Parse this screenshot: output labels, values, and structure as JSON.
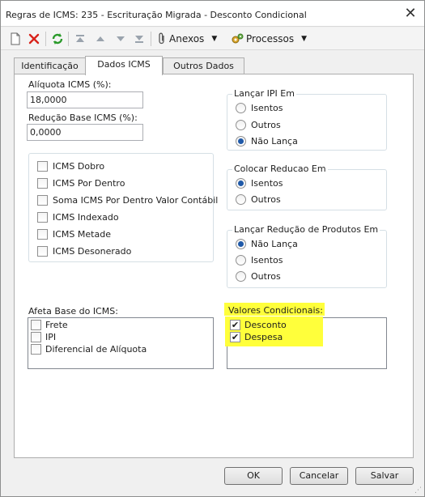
{
  "window": {
    "title": "Regras de ICMS: 235 - Escrituração Migrada - Desconto Condicional",
    "close_glyph": "✕"
  },
  "toolbar": {
    "icons": [
      "new-icon",
      "delete-icon",
      "refresh-icon",
      "first-icon",
      "previous-icon",
      "next-icon",
      "last-icon"
    ],
    "anexos_label": "Anexos",
    "processos_label": "Processos"
  },
  "tabs": [
    {
      "label": "Identificação",
      "active": false
    },
    {
      "label": "Dados ICMS",
      "active": true
    },
    {
      "label": "Outros Dados",
      "active": false
    }
  ],
  "fields": {
    "aliquota_label": "Alíquota ICMS (%):",
    "aliquota_value": "18,0000",
    "reducao_label": "Redução Base ICMS (%):",
    "reducao_value": "0,0000"
  },
  "icms_options": [
    {
      "label": "ICMS Dobro",
      "checked": false
    },
    {
      "label": "ICMS Por Dentro",
      "checked": false
    },
    {
      "label": "Soma ICMS Por Dentro Valor Contábil",
      "checked": false
    },
    {
      "label": "ICMS Indexado",
      "checked": false
    },
    {
      "label": "ICMS Metade",
      "checked": false
    },
    {
      "label": "ICMS Desonerado",
      "checked": false
    }
  ],
  "lancar_ipi": {
    "title": "Lançar IPI Em",
    "options": [
      {
        "label": "Isentos",
        "selected": false
      },
      {
        "label": "Outros",
        "selected": false
      },
      {
        "label": "Não Lança",
        "selected": true
      }
    ]
  },
  "colocar_reducao": {
    "title": "Colocar Reducao Em",
    "options": [
      {
        "label": "Isentos",
        "selected": true
      },
      {
        "label": "Outros",
        "selected": false
      }
    ]
  },
  "lancar_reducao_produtos": {
    "title": "Lançar Redução de Produtos Em",
    "options": [
      {
        "label": "Não Lança",
        "selected": true
      },
      {
        "label": "Isentos",
        "selected": false
      },
      {
        "label": "Outros",
        "selected": false
      }
    ]
  },
  "afeta_base": {
    "title": "Afeta Base do ICMS:",
    "items": [
      {
        "label": "Frete",
        "checked": false
      },
      {
        "label": "IPI",
        "checked": false
      },
      {
        "label": "Diferencial de Alíquota",
        "checked": false
      }
    ]
  },
  "valores_condicionais": {
    "title": "Valores Condicionais:",
    "items": [
      {
        "label": "Desconto",
        "checked": true
      },
      {
        "label": "Despesa",
        "checked": true
      }
    ],
    "highlight_color": "#ffff3b"
  },
  "buttons": {
    "ok": "OK",
    "cancel": "Cancelar",
    "save": "Salvar"
  },
  "colors": {
    "radio_dot": "#1f59a8",
    "window_bg": "#f0f0f0"
  }
}
